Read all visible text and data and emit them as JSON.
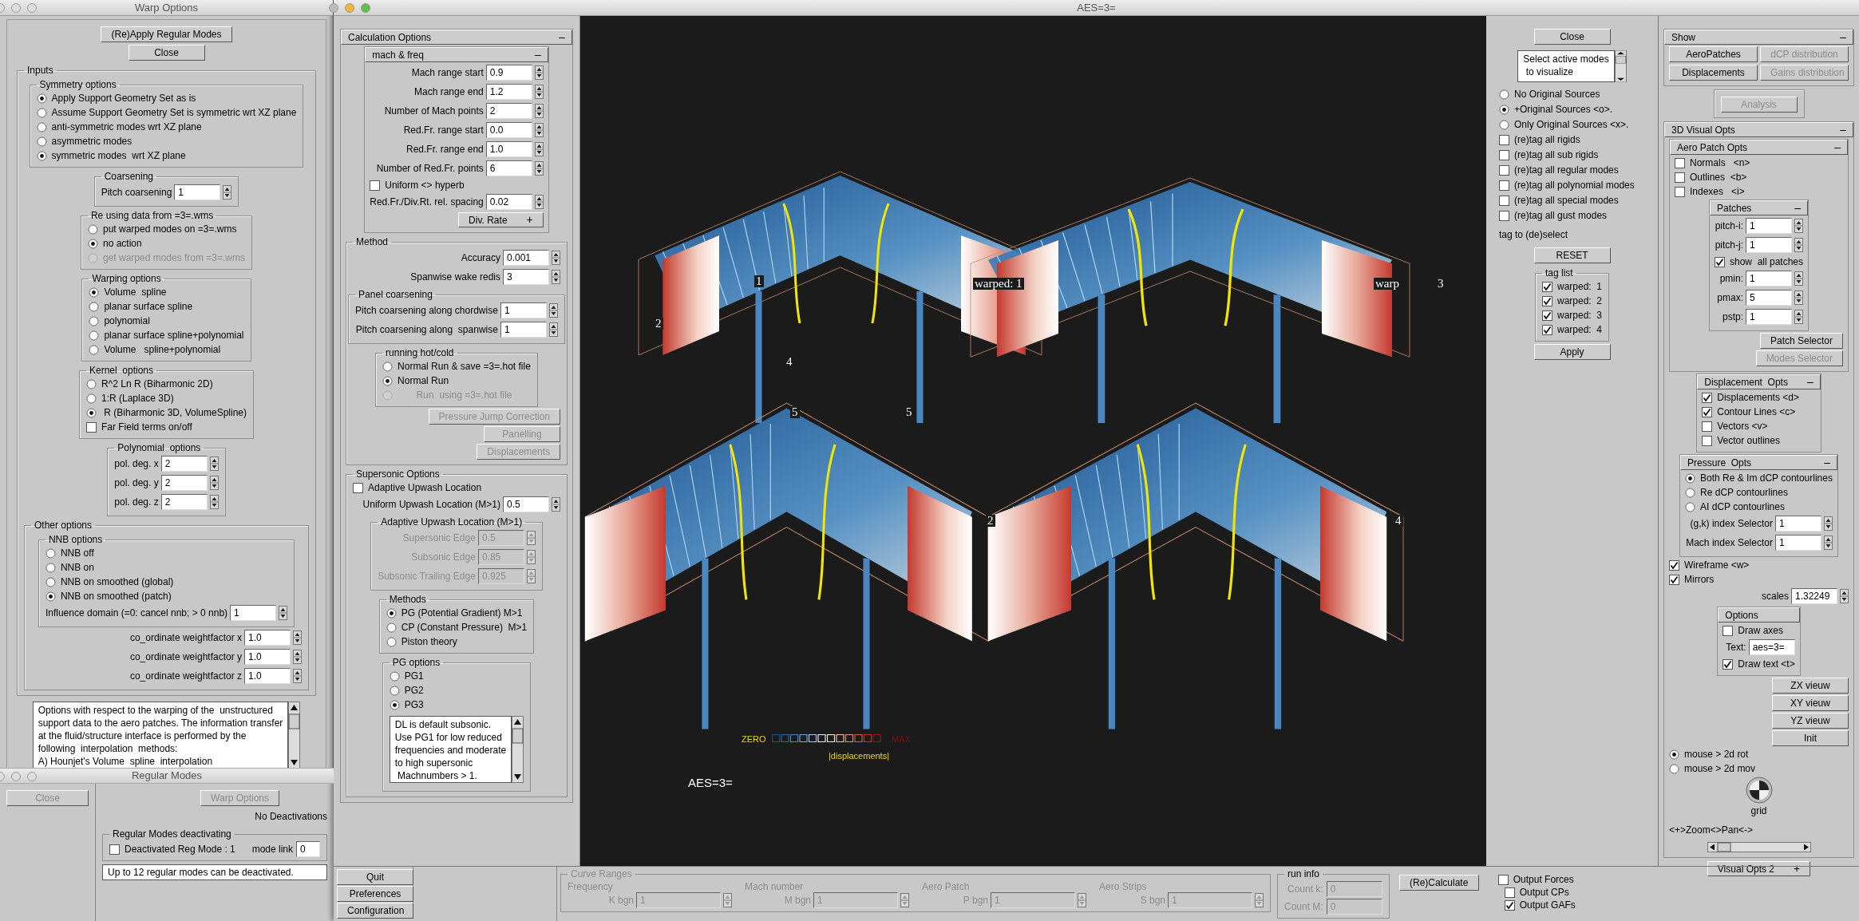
{
  "warp_options": {
    "title": "Warp Options",
    "items": [
      {
        "kind": "button",
        "label": "(Re)Apply Regular Modes",
        "disabled": false
      },
      {
        "kind": "button",
        "label": "Close",
        "disabled": false
      },
      {
        "kind": "group",
        "title": "Inputs",
        "items": [
          {
            "kind": "group",
            "title": "Symmetry options",
            "items": [
              {
                "kind": "radio",
                "label": "Apply Support Geometry Set as is",
                "selected": true
              },
              {
                "kind": "radio",
                "label": "Assume Support Geometry Set is symmetric wrt XZ plane",
                "selected": false
              },
              {
                "kind": "radio",
                "label": "anti-symmetric modes wrt XZ plane",
                "selected": false
              },
              {
                "kind": "radio",
                "label": "asymmetric modes",
                "selected": false
              },
              {
                "kind": "radio",
                "label": "symmetric modes  wrt XZ plane",
                "selected": true
              }
            ]
          },
          {
            "kind": "group",
            "title": "Coarsening",
            "items": [
              {
                "kind": "spin",
                "label": "Pitch coarsening",
                "value": "1"
              }
            ]
          },
          {
            "kind": "group",
            "title": "Re using data from =3=.wms",
            "items": [
              {
                "kind": "radio",
                "label": "put warped modes on =3=.wms",
                "selected": false,
                "disabled": false
              },
              {
                "kind": "radio",
                "label": "no action",
                "selected": true,
                "disabled": false
              },
              {
                "kind": "radio",
                "label": "get warped modes from =3=.wms",
                "selected": false,
                "disabled": true
              }
            ]
          },
          {
            "kind": "group",
            "title": "Warping options",
            "items": [
              {
                "kind": "radio",
                "label": "Volume  spline",
                "selected": true
              },
              {
                "kind": "radio",
                "label": "planar surface spline",
                "selected": false
              },
              {
                "kind": "radio",
                "label": "polynomial",
                "selected": false
              },
              {
                "kind": "radio",
                "label": "planar surface spline+polynomial",
                "selected": false
              },
              {
                "kind": "radio",
                "label": "Volume   spline+polynomial",
                "selected": false
              }
            ]
          },
          {
            "kind": "group",
            "title": "Kernel  options",
            "items": [
              {
                "kind": "radio",
                "label": "R^2 Ln R (Biharmonic 2D)",
                "selected": false
              },
              {
                "kind": "radio",
                "label": "1:R (Laplace 3D)",
                "selected": false
              },
              {
                "kind": "radio",
                "label": " R (Biharmonic 3D, VolumeSpline)",
                "selected": true
              },
              {
                "kind": "checkbox",
                "label": "Far Field terms on/off",
                "checked": false
              }
            ]
          },
          {
            "kind": "group",
            "title": "Polynomial  options",
            "items": [
              {
                "kind": "spin",
                "label": "pol. deg. x",
                "value": "2"
              },
              {
                "kind": "spin",
                "label": "pol. deg. y",
                "value": "2"
              },
              {
                "kind": "spin",
                "label": "pol. deg. z",
                "value": "2"
              }
            ]
          },
          {
            "kind": "group",
            "title": "Other options",
            "items": [
              {
                "kind": "group",
                "title": "NNB options",
                "items": [
                  {
                    "kind": "radio",
                    "label": "NNB off",
                    "selected": false
                  },
                  {
                    "kind": "radio",
                    "label": "NNB on",
                    "selected": false
                  },
                  {
                    "kind": "radio",
                    "label": "NNB on smoothed (global)",
                    "selected": false
                  },
                  {
                    "kind": "radio",
                    "label": "NNB on smoothed (patch)",
                    "selected": true
                  },
                  {
                    "kind": "spin",
                    "label": "Influence domain (=0: cancel nnb; > 0 nnb)",
                    "value": "1"
                  }
                ]
              },
              {
                "kind": "spin",
                "label": "co_ordinate weightfactor x",
                "value": "1.0"
              },
              {
                "kind": "spin",
                "label": "co_ordinate weightfactor y",
                "value": "1.0"
              },
              {
                "kind": "spin",
                "label": "co_ordinate weightfactor z",
                "value": "1.0"
              }
            ]
          }
        ]
      },
      {
        "kind": "textarea",
        "text": "Options with respect to the warping of the  unstructured\nsupport data to the aero patches. The information transfer\nat the fluid/structure interface is performed by the\nfollowing  interpolation  methods:\nA) Hounjet's Volume  spline  interpolation"
      }
    ]
  },
  "regular_modes": {
    "title": "Regular Modes",
    "close": {
      "label": "Close",
      "disabled": true
    },
    "warp_button": {
      "label": "Warp Options",
      "disabled": true
    },
    "status": "No Deactivations",
    "group": {
      "title": "Regular Modes deactivating",
      "checkbox": {
        "label": "Deactivated Reg Mode : 1",
        "checked": false
      },
      "link_label": "mode link",
      "link_value": "0"
    },
    "message": "Up to 12 regular modes can be deactivated."
  },
  "aes_window": {
    "title": "AES=3=",
    "calc_panel": {
      "items": [
        {
          "kind": "section",
          "title": "Calculation Options",
          "toggle": "–",
          "items": [
            {
              "kind": "section",
              "title": "mach & freq",
              "toggle": "–",
              "items": [
                {
                  "kind": "spin",
                  "label": "Mach range start",
                  "value": "0.9"
                },
                {
                  "kind": "spin",
                  "label": "Mach range end",
                  "value": "1.2"
                },
                {
                  "kind": "spin",
                  "label": "Number of Mach points",
                  "value": "2"
                },
                {
                  "kind": "spin",
                  "label": "Red.Fr. range start",
                  "value": "0.0"
                },
                {
                  "kind": "spin",
                  "label": "Red.Fr. range end",
                  "value": "1.0"
                },
                {
                  "kind": "spin",
                  "label": "Number of Red.Fr. points",
                  "value": "6"
                },
                {
                  "kind": "checkbox",
                  "label": "Uniform <> hyperb",
                  "checked": false
                },
                {
                  "kind": "spin",
                  "label": "Red.Fr./Div.Rt. rel. spacing",
                  "value": "0.02"
                },
                {
                  "kind": "toggle_button",
                  "label": "Div. Rate",
                  "toggle": "+"
                }
              ]
            },
            {
              "kind": "group",
              "title": "Method",
              "items": [
                {
                  "kind": "spin",
                  "label": "Accuracy",
                  "value": "0.001"
                },
                {
                  "kind": "spin",
                  "label": "Spanwise wake redis",
                  "value": "3"
                },
                {
                  "kind": "group",
                  "title": "Panel coarsening",
                  "items": [
                    {
                      "kind": "spin",
                      "label": "Pitch coarsening along chordwise",
                      "value": "1"
                    },
                    {
                      "kind": "spin",
                      "label": "Pitch coarsening along  spanwise",
                      "value": "1"
                    }
                  ]
                },
                {
                  "kind": "group",
                  "title": "running hot/cold",
                  "items": [
                    {
                      "kind": "radio",
                      "label": "Normal Run & save =3=.hot file",
                      "selected": false,
                      "disabled": false
                    },
                    {
                      "kind": "radio",
                      "label": "Normal Run",
                      "selected": true,
                      "disabled": false
                    },
                    {
                      "kind": "radio",
                      "label": "       Run  using =3=.hot file",
                      "selected": false,
                      "disabled": true
                    }
                  ]
                },
                {
                  "kind": "button",
                  "label": "Pressure Jump Correction",
                  "disabled": true
                },
                {
                  "kind": "button",
                  "label": "Panelling",
                  "disabled": true
                },
                {
                  "kind": "button",
                  "label": "Displacements",
                  "disabled": true
                }
              ]
            },
            {
              "kind": "group",
              "title": "Supersonic Options",
              "items": [
                {
                  "kind": "checkbox",
                  "label": "Adaptive Upwash Location",
                  "checked": false
                },
                {
                  "kind": "spin",
                  "label": "Uniform Upwash Location (M>1)",
                  "value": "0.5"
                },
                {
                  "kind": "group",
                  "title": "Adaptive Upwash Location (M>1)",
                  "items": [
                    {
                      "kind": "spin",
                      "label": "Supersonic Edge",
                      "value": "0.5",
                      "disabled": true
                    },
                    {
                      "kind": "spin",
                      "label": "Subsonic Edge",
                      "value": "0.85",
                      "disabled": true
                    },
                    {
                      "kind": "spin",
                      "label": "Subsonic Trailing Edge",
                      "value": "0.925",
                      "disabled": true
                    }
                  ]
                },
                {
                  "kind": "group",
                  "title": "Methods",
                  "items": [
                    {
                      "kind": "radio",
                      "label": "PG (Potential Gradient) M>1",
                      "selected": true
                    },
                    {
                      "kind": "radio",
                      "label": "CP (Constant Pressure)  M>1",
                      "selected": false
                    },
                    {
                      "kind": "radio",
                      "label": "Piston theory",
                      "selected": false
                    }
                  ]
                },
                {
                  "kind": "group",
                  "title": "PG options",
                  "items": [
                    {
                      "kind": "radio",
                      "label": "PG1",
                      "selected": false
                    },
                    {
                      "kind": "radio",
                      "label": "PG2",
                      "selected": false
                    },
                    {
                      "kind": "radio",
                      "label": "PG3",
                      "selected": true
                    },
                    {
                      "kind": "textarea",
                      "text": "DL is default subsonic.\nUse PG1 for low reduced\nfrequencies and moderate\nto high supersonic\n Machnumbers > 1."
                    }
                  ]
                }
              ]
            }
          ]
        }
      ]
    },
    "viewport": {
      "labels": [
        "1",
        "2",
        "4",
        "5",
        "5",
        "warped: 1",
        "warp",
        "3",
        "2",
        "4"
      ],
      "legend": {
        "low": "ZERO",
        "high": "MAX",
        "caption": "|displacements|"
      },
      "caption": "AES=3="
    },
    "tag_panel": {
      "items": [
        {
          "kind": "button",
          "label": "Close",
          "disabled": false
        },
        {
          "kind": "textarea",
          "text": "Select active modes\n to visualize"
        },
        {
          "kind": "radio",
          "label": "No Original Sources",
          "selected": false
        },
        {
          "kind": "radio",
          "label": "+Original Sources <o>.",
          "selected": true
        },
        {
          "kind": "radio",
          "label": "Only Original Sources <x>.",
          "selected": false
        },
        {
          "kind": "checkbox",
          "label": "(re)tag all rigids",
          "checked": false
        },
        {
          "kind": "checkbox",
          "label": "(re)tag all sub rigids",
          "checked": false
        },
        {
          "kind": "checkbox",
          "label": "(re)tag all regular modes",
          "checked": false
        },
        {
          "kind": "checkbox",
          "label": "(re)tag all polynomial modes",
          "checked": false
        },
        {
          "kind": "checkbox",
          "label": "(re)tag all special modes",
          "checked": false
        },
        {
          "kind": "checkbox",
          "label": "(re)tag all gust modes",
          "checked": false
        },
        {
          "kind": "text",
          "text": "tag to (de)select"
        },
        {
          "kind": "button",
          "label": "RESET",
          "disabled": false
        },
        {
          "kind": "group",
          "title": "tag list",
          "items": [
            {
              "kind": "checkbox",
              "label": "warped:  1",
              "checked": true
            },
            {
              "kind": "checkbox",
              "label": "warped:  2",
              "checked": true
            },
            {
              "kind": "checkbox",
              "label": "warped:  3",
              "checked": true
            },
            {
              "kind": "checkbox",
              "label": "warped:  4",
              "checked": true
            }
          ]
        },
        {
          "kind": "button",
          "label": "Apply",
          "disabled": false
        }
      ]
    },
    "show_panel": {
      "items": [
        {
          "kind": "section",
          "title": "Show",
          "toggle": "–",
          "items": [
            {
              "kind": "button_grid",
              "buttons": [
                {
                  "label": "AeroPatches",
                  "disabled": false
                },
                {
                  "label": "dCP distribution",
                  "disabled": true
                },
                {
                  "label": "Displacements",
                  "disabled": false
                },
                {
                  "label": "Gains distribution",
                  "disabled": true
                }
              ]
            }
          ]
        },
        {
          "kind": "group",
          "items": [
            {
              "kind": "button",
              "label": "Analysis",
              "disabled": true
            }
          ]
        },
        {
          "kind": "section",
          "title": "3D Visual Opts",
          "toggle": "–",
          "items": [
            {
              "kind": "section",
              "title": "Aero Patch Opts",
              "toggle": "–",
              "items": [
                {
                  "kind": "checkbox",
                  "label": "Normals   <n>",
                  "checked": false
                },
                {
                  "kind": "checkbox",
                  "label": "Outlines  <b>",
                  "checked": false
                },
                {
                  "kind": "checkbox",
                  "label": "Indexes   <i>",
                  "checked": false
                },
                {
                  "kind": "section",
                  "title": "Patches",
                  "toggle": "–",
                  "items": [
                    {
                      "kind": "spin",
                      "label": "pitch-i:",
                      "value": "1"
                    },
                    {
                      "kind": "spin",
                      "label": "pitch-j:",
                      "value": "1"
                    },
                    {
                      "kind": "checkbox",
                      "label": "show  all patches",
                      "checked": true
                    },
                    {
                      "kind": "spin",
                      "label": "pmin:",
                      "value": "1"
                    },
                    {
                      "kind": "spin",
                      "label": "pmax:",
                      "value": "5"
                    },
                    {
                      "kind": "spin",
                      "label": "pstp:",
                      "value": "1"
                    }
                  ]
                },
                {
                  "kind": "button",
                  "label": "Patch Selector",
                  "disabled": false
                },
                {
                  "kind": "button",
                  "label": "Modes Selector",
                  "disabled": true
                }
              ]
            },
            {
              "kind": "section",
              "title": "Displacement  Opts",
              "toggle": "–",
              "items": [
                {
                  "kind": "checkbox",
                  "label": "Displacements <d>",
                  "checked": true
                },
                {
                  "kind": "checkbox",
                  "label": "Contour Lines <c>",
                  "checked": true
                },
                {
                  "kind": "checkbox",
                  "label": "Vectors <v>",
                  "checked": false
                },
                {
                  "kind": "checkbox",
                  "label": "Vector outlines",
                  "checked": false
                }
              ]
            },
            {
              "kind": "section",
              "title": "Pressure  Opts",
              "toggle": "–",
              "items": [
                {
                  "kind": "radio",
                  "label": "Both Re & Im dCP contourlines",
                  "selected": true
                },
                {
                  "kind": "radio",
                  "label": "Re dCP contourlines",
                  "selected": false
                },
                {
                  "kind": "radio",
                  "label": "AI dCP contourlines",
                  "selected": false
                },
                {
                  "kind": "spin",
                  "label": "(g,k) index Selector",
                  "value": "1"
                },
                {
                  "kind": "spin",
                  "label": "Mach index Selector",
                  "value": "1"
                }
              ]
            },
            {
              "kind": "checkbox",
              "label": "Wireframe <w>",
              "checked": true
            },
            {
              "kind": "checkbox",
              "label": "Mirrors",
              "checked": true
            },
            {
              "kind": "spin",
              "label": "scales",
              "value": "1.32249"
            },
            {
              "kind": "section",
              "title": "Options",
              "items": [
                {
                  "kind": "checkbox",
                  "label": "Draw axes",
                  "checked": false
                },
                {
                  "kind": "field",
                  "label": "Text:",
                  "value": "aes=3="
                },
                {
                  "kind": "checkbox",
                  "label": "Draw text <t>",
                  "checked": true
                }
              ]
            },
            {
              "kind": "button",
              "label": "ZX vieuw",
              "disabled": false
            },
            {
              "kind": "button",
              "label": "XY vieuw",
              "disabled": false
            },
            {
              "kind": "button",
              "label": "YZ vieuw",
              "disabled": false
            },
            {
              "kind": "button",
              "label": "Init",
              "disabled": false
            },
            {
              "kind": "radio",
              "label": "mouse > 2d rot",
              "selected": true
            },
            {
              "kind": "radio",
              "label": "mouse > 2d mov",
              "selected": false
            },
            {
              "kind": "trackball",
              "label": "grid"
            },
            {
              "kind": "text",
              "text": "<+>Zoom<>Pan<->"
            },
            {
              "kind": "scrollbar"
            }
          ]
        },
        {
          "kind": "toggle_button",
          "label": "Visual Opts 2",
          "toggle": "+"
        }
      ]
    },
    "bottom_bar": {
      "buttons": [
        {
          "label": "Quit",
          "disabled": false
        },
        {
          "label": "Preferences",
          "disabled": false
        },
        {
          "label": "Configuration",
          "disabled": false
        }
      ],
      "curve_ranges": {
        "title": "Curve Ranges",
        "columns": [
          {
            "heading": "Frequency",
            "label": "K bgn",
            "value": "1"
          },
          {
            "heading": "Mach number",
            "label": "M bgn",
            "value": "1"
          },
          {
            "heading": "Aero Patch",
            "label": "P bgn",
            "value": "1"
          },
          {
            "heading": "Aero Strips",
            "label": "S bgn",
            "value": "1"
          }
        ]
      },
      "run_info": {
        "title": "run info",
        "fields": [
          {
            "label": "Count k:",
            "value": "0"
          },
          {
            "label": "Count M:",
            "value": "0"
          }
        ]
      },
      "calculate": {
        "label": "(Re)Calculate",
        "disabled": false
      },
      "outputs": [
        {
          "label": "Output Forces",
          "checked": false
        },
        {
          "label": "Output CPs",
          "checked": false
        },
        {
          "label": "Output GAFs",
          "checked": true
        }
      ]
    }
  }
}
